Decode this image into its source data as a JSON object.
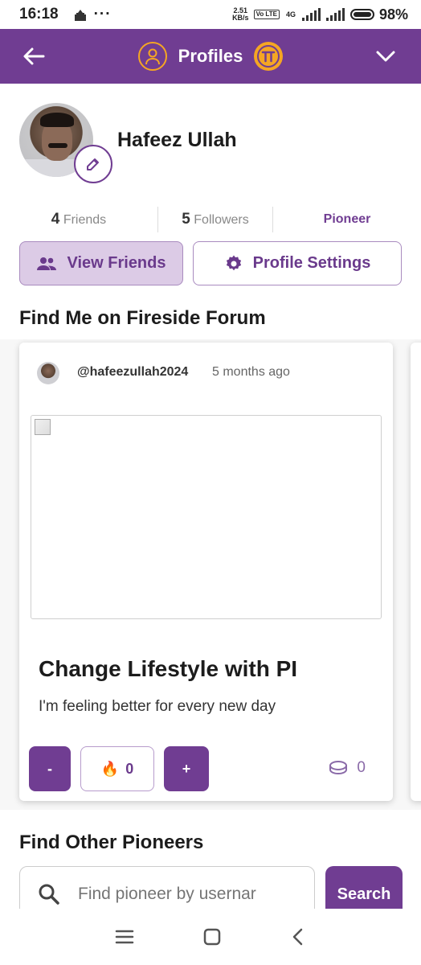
{
  "status_bar": {
    "time": "16:18",
    "net_speed_value": "2.51",
    "net_speed_unit": "KB/s",
    "volte": "Vo LTE",
    "network": "4G",
    "battery": "98%"
  },
  "header": {
    "title": "Profiles"
  },
  "profile": {
    "name": "Hafeez Ullah",
    "friends_count": "4",
    "friends_label": "Friends",
    "followers_count": "5",
    "followers_label": "Followers",
    "role": "Pioneer",
    "view_friends_label": "View Friends",
    "settings_label": "Profile Settings"
  },
  "forum": {
    "section_title": "Find Me on Fireside Forum",
    "post": {
      "handle": "@hafeezullah2024",
      "time": "5 months ago",
      "title": "Change Lifestyle with PI",
      "body": "I'm feeling better for every new day",
      "minus_label": "-",
      "fire_emoji": "🔥",
      "fire_count": "0",
      "plus_label": "+",
      "coin_count": "0"
    }
  },
  "find_pioneers": {
    "section_title": "Find Other Pioneers",
    "search_placeholder": "Find pioneer by usernar",
    "search_button": "Search"
  },
  "colors": {
    "brand": "#703d92",
    "accent": "#f5a623"
  }
}
